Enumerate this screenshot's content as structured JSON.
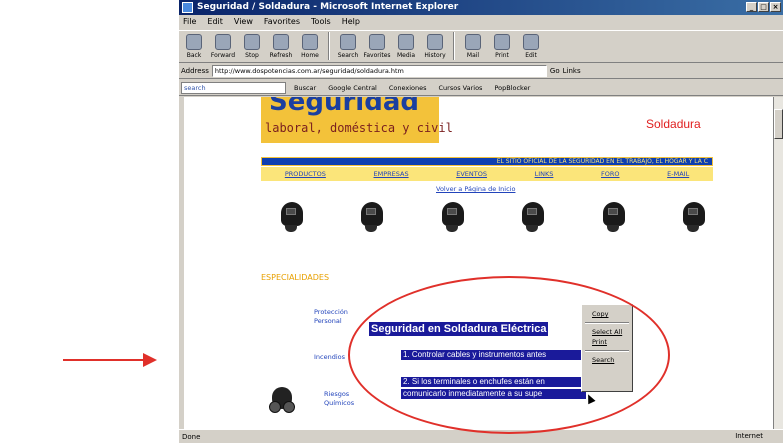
{
  "window": {
    "title": "Seguridad / Soldadura - Microsoft Internet Explorer",
    "buttons": [
      "_",
      "□",
      "×"
    ]
  },
  "menubar": [
    "File",
    "Edit",
    "View",
    "Favorites",
    "Tools",
    "Help"
  ],
  "toolbar": [
    {
      "label": "Back",
      "icon": "back-arrow-icon"
    },
    {
      "label": "Forward",
      "icon": "forward-arrow-icon"
    },
    {
      "label": "Stop",
      "icon": "stop-icon"
    },
    {
      "label": "Refresh",
      "icon": "refresh-icon"
    },
    {
      "label": "Home",
      "icon": "home-icon"
    },
    {
      "label": "Search",
      "icon": "search-icon"
    },
    {
      "label": "Favorites",
      "icon": "favorites-icon"
    },
    {
      "label": "Media",
      "icon": "media-icon"
    },
    {
      "label": "History",
      "icon": "history-icon"
    },
    {
      "label": "Mail",
      "icon": "mail-icon"
    },
    {
      "label": "Print",
      "icon": "print-icon"
    },
    {
      "label": "Edit",
      "icon": "edit-icon"
    }
  ],
  "address": {
    "label": "Address",
    "url": "http://www.dospotencias.com.ar/seguridad/soldadura.htm",
    "go": "Go",
    "links": "Links"
  },
  "linksbar": {
    "search_placeholder": "search",
    "items": [
      "Buscar",
      "Google Central",
      "Conexiones",
      "Cursos Varios",
      "PopBlocker"
    ]
  },
  "page": {
    "banner_title": "Seguridad",
    "banner_subtitle": "laboral, doméstica y civil",
    "section_title": "Soldadura",
    "slogan": "EL SITIO OFICIAL DE LA SEGURIDAD EN EL TRABAJO, EL HOGAR Y LA C",
    "nav": [
      "PRODUCTOS",
      "EMPRESAS",
      "EVENTOS",
      "LINKS",
      "FORO",
      "E-MAIL"
    ],
    "back_link": "Volver a Página de Inicio",
    "especialidades": "ESPECIALIDADES",
    "side_links": [
      "Protección Personal",
      "Incendios",
      "Riesgos Químicos"
    ],
    "selected_heading": "Seguridad en Soldadura Eléctrica",
    "selected_lines": [
      "1. Controlar cables y instrumentos antes",
      "2. Si los terminales o enchufes están en",
      "comunicarlo inmediatamente a su supe"
    ]
  },
  "context_menu": {
    "items": [
      "Copy",
      "Select All",
      "Print",
      "Search"
    ]
  },
  "statusbar": {
    "status": "Done",
    "zone": "Internet"
  }
}
